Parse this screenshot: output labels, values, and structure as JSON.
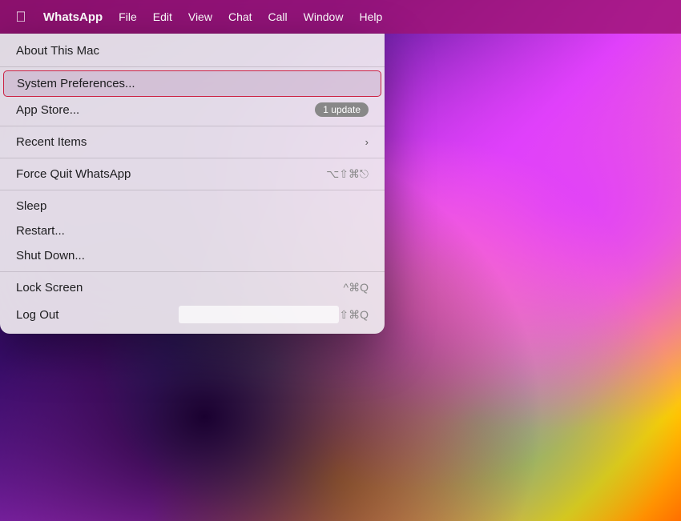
{
  "desktop": {
    "bg_description": "macOS colorful gradient wallpaper"
  },
  "menubar": {
    "apple_symbol": "&#63743;",
    "items": [
      {
        "id": "whatsapp",
        "label": "WhatsApp",
        "bold": true
      },
      {
        "id": "file",
        "label": "File"
      },
      {
        "id": "edit",
        "label": "Edit"
      },
      {
        "id": "view",
        "label": "View"
      },
      {
        "id": "chat",
        "label": "Chat"
      },
      {
        "id": "call",
        "label": "Call"
      },
      {
        "id": "window",
        "label": "Window"
      },
      {
        "id": "help",
        "label": "Help"
      }
    ]
  },
  "apple_menu": {
    "items": [
      {
        "id": "about-this-mac",
        "label": "About This Mac",
        "shortcut": "",
        "type": "item",
        "separator_after": false
      },
      {
        "id": "separator-1",
        "type": "separator"
      },
      {
        "id": "system-preferences",
        "label": "System Preferences...",
        "shortcut": "",
        "type": "item",
        "highlighted": true,
        "separator_after": false
      },
      {
        "id": "app-store",
        "label": "App Store...",
        "badge": "1 update",
        "type": "item",
        "separator_after": false
      },
      {
        "id": "separator-2",
        "type": "separator"
      },
      {
        "id": "recent-items",
        "label": "Recent Items",
        "hasSubmenu": true,
        "type": "item",
        "separator_after": false
      },
      {
        "id": "separator-3",
        "type": "separator"
      },
      {
        "id": "force-quit",
        "label": "Force Quit WhatsApp",
        "shortcut": "⌥⇧⌘⎋",
        "type": "item",
        "separator_after": false
      },
      {
        "id": "separator-4",
        "type": "separator"
      },
      {
        "id": "sleep",
        "label": "Sleep",
        "type": "item",
        "separator_after": false
      },
      {
        "id": "restart",
        "label": "Restart...",
        "type": "item",
        "separator_after": false
      },
      {
        "id": "shut-down",
        "label": "Shut Down...",
        "type": "item",
        "separator_after": false
      },
      {
        "id": "separator-5",
        "type": "separator"
      },
      {
        "id": "lock-screen",
        "label": "Lock Screen",
        "shortcut": "^⌘Q",
        "type": "item",
        "separator_after": false
      },
      {
        "id": "log-out",
        "label": "Log Out",
        "shortcut": "⇧⌘Q",
        "type": "item",
        "redacted": true,
        "separator_after": false
      }
    ]
  }
}
